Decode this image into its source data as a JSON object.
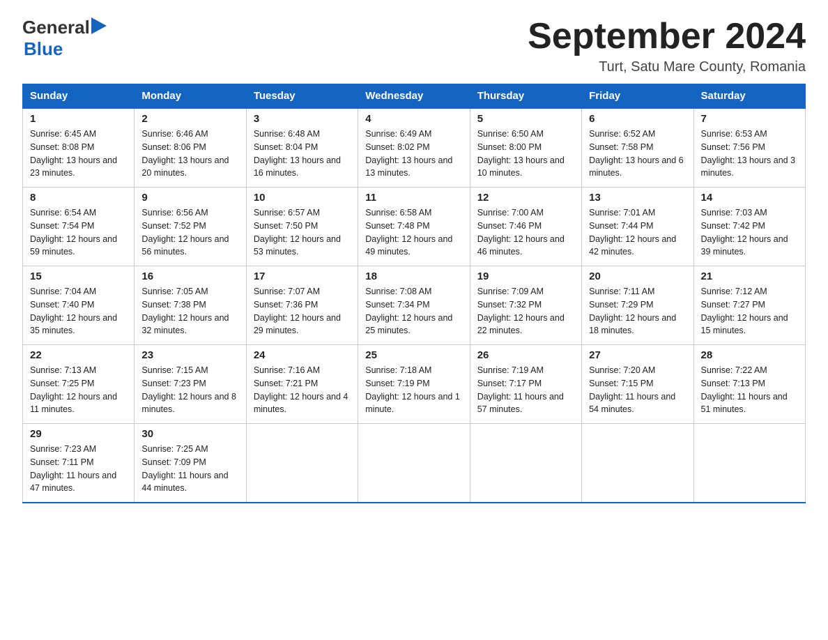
{
  "logo": {
    "text_general": "General",
    "triangle": "▶",
    "text_blue": "Blue"
  },
  "title": "September 2024",
  "subtitle": "Turt, Satu Mare County, Romania",
  "headers": [
    "Sunday",
    "Monday",
    "Tuesday",
    "Wednesday",
    "Thursday",
    "Friday",
    "Saturday"
  ],
  "weeks": [
    [
      {
        "day": "1",
        "sunrise": "6:45 AM",
        "sunset": "8:08 PM",
        "daylight": "13 hours and 23 minutes."
      },
      {
        "day": "2",
        "sunrise": "6:46 AM",
        "sunset": "8:06 PM",
        "daylight": "13 hours and 20 minutes."
      },
      {
        "day": "3",
        "sunrise": "6:48 AM",
        "sunset": "8:04 PM",
        "daylight": "13 hours and 16 minutes."
      },
      {
        "day": "4",
        "sunrise": "6:49 AM",
        "sunset": "8:02 PM",
        "daylight": "13 hours and 13 minutes."
      },
      {
        "day": "5",
        "sunrise": "6:50 AM",
        "sunset": "8:00 PM",
        "daylight": "13 hours and 10 minutes."
      },
      {
        "day": "6",
        "sunrise": "6:52 AM",
        "sunset": "7:58 PM",
        "daylight": "13 hours and 6 minutes."
      },
      {
        "day": "7",
        "sunrise": "6:53 AM",
        "sunset": "7:56 PM",
        "daylight": "13 hours and 3 minutes."
      }
    ],
    [
      {
        "day": "8",
        "sunrise": "6:54 AM",
        "sunset": "7:54 PM",
        "daylight": "12 hours and 59 minutes."
      },
      {
        "day": "9",
        "sunrise": "6:56 AM",
        "sunset": "7:52 PM",
        "daylight": "12 hours and 56 minutes."
      },
      {
        "day": "10",
        "sunrise": "6:57 AM",
        "sunset": "7:50 PM",
        "daylight": "12 hours and 53 minutes."
      },
      {
        "day": "11",
        "sunrise": "6:58 AM",
        "sunset": "7:48 PM",
        "daylight": "12 hours and 49 minutes."
      },
      {
        "day": "12",
        "sunrise": "7:00 AM",
        "sunset": "7:46 PM",
        "daylight": "12 hours and 46 minutes."
      },
      {
        "day": "13",
        "sunrise": "7:01 AM",
        "sunset": "7:44 PM",
        "daylight": "12 hours and 42 minutes."
      },
      {
        "day": "14",
        "sunrise": "7:03 AM",
        "sunset": "7:42 PM",
        "daylight": "12 hours and 39 minutes."
      }
    ],
    [
      {
        "day": "15",
        "sunrise": "7:04 AM",
        "sunset": "7:40 PM",
        "daylight": "12 hours and 35 minutes."
      },
      {
        "day": "16",
        "sunrise": "7:05 AM",
        "sunset": "7:38 PM",
        "daylight": "12 hours and 32 minutes."
      },
      {
        "day": "17",
        "sunrise": "7:07 AM",
        "sunset": "7:36 PM",
        "daylight": "12 hours and 29 minutes."
      },
      {
        "day": "18",
        "sunrise": "7:08 AM",
        "sunset": "7:34 PM",
        "daylight": "12 hours and 25 minutes."
      },
      {
        "day": "19",
        "sunrise": "7:09 AM",
        "sunset": "7:32 PM",
        "daylight": "12 hours and 22 minutes."
      },
      {
        "day": "20",
        "sunrise": "7:11 AM",
        "sunset": "7:29 PM",
        "daylight": "12 hours and 18 minutes."
      },
      {
        "day": "21",
        "sunrise": "7:12 AM",
        "sunset": "7:27 PM",
        "daylight": "12 hours and 15 minutes."
      }
    ],
    [
      {
        "day": "22",
        "sunrise": "7:13 AM",
        "sunset": "7:25 PM",
        "daylight": "12 hours and 11 minutes."
      },
      {
        "day": "23",
        "sunrise": "7:15 AM",
        "sunset": "7:23 PM",
        "daylight": "12 hours and 8 minutes."
      },
      {
        "day": "24",
        "sunrise": "7:16 AM",
        "sunset": "7:21 PM",
        "daylight": "12 hours and 4 minutes."
      },
      {
        "day": "25",
        "sunrise": "7:18 AM",
        "sunset": "7:19 PM",
        "daylight": "12 hours and 1 minute."
      },
      {
        "day": "26",
        "sunrise": "7:19 AM",
        "sunset": "7:17 PM",
        "daylight": "11 hours and 57 minutes."
      },
      {
        "day": "27",
        "sunrise": "7:20 AM",
        "sunset": "7:15 PM",
        "daylight": "11 hours and 54 minutes."
      },
      {
        "day": "28",
        "sunrise": "7:22 AM",
        "sunset": "7:13 PM",
        "daylight": "11 hours and 51 minutes."
      }
    ],
    [
      {
        "day": "29",
        "sunrise": "7:23 AM",
        "sunset": "7:11 PM",
        "daylight": "11 hours and 47 minutes."
      },
      {
        "day": "30",
        "sunrise": "7:25 AM",
        "sunset": "7:09 PM",
        "daylight": "11 hours and 44 minutes."
      },
      null,
      null,
      null,
      null,
      null
    ]
  ]
}
